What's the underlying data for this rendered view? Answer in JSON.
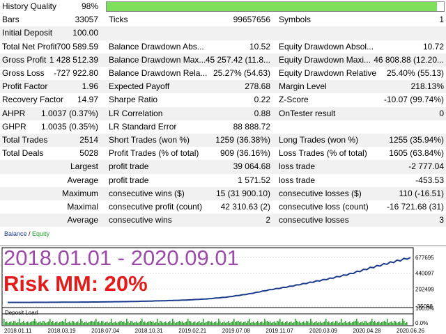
{
  "history_quality": {
    "label": "History Quality",
    "value": "98%",
    "fraction": 0.98
  },
  "stats": [
    {
      "l1": "Bars",
      "v1": "33057",
      "l2": "Ticks",
      "v2": "99657656",
      "l3": "Symbols",
      "v3": "1"
    },
    {
      "l1": "Initial Deposit",
      "v1": "100.00",
      "l2": "",
      "v2": "",
      "l3": "",
      "v3": ""
    },
    {
      "l1": "Total Net Profit",
      "v1": "700 589.59",
      "l2": "Balance Drawdown Abs...",
      "v2": "10.52",
      "l3": "Equity Drawdown Absol...",
      "v3": "10.72"
    },
    {
      "l1": "Gross Profit",
      "v1": "1 428 512.39",
      "l2": "Balance Drawdown Max...",
      "v2": "45 257.42 (11.8...",
      "l3": "Equity Drawdown Maxi...",
      "v3": "46 808.88 (12.20..."
    },
    {
      "l1": "Gross Loss",
      "v1": "-727 922.80",
      "l2": "Balance Drawdown Rela...",
      "v2": "25.27% (54.63)",
      "l3": "Equity Drawdown Relative",
      "v3": "25.40% (55.13)"
    },
    {
      "l1": "Profit Factor",
      "v1": "1.96",
      "l2": "Expected Payoff",
      "v2": "278.68",
      "l3": "Margin Level",
      "v3": "218.13%"
    },
    {
      "l1": "Recovery Factor",
      "v1": "14.97",
      "l2": "Sharpe Ratio",
      "v2": "0.22",
      "l3": "Z-Score",
      "v3": "-10.07 (99.74%)"
    },
    {
      "l1": "AHPR",
      "v1": "1.0037 (0.37%)",
      "l2": "LR Correlation",
      "v2": "0.88",
      "l3": "OnTester result",
      "v3": "0"
    },
    {
      "l1": "GHPR",
      "v1": "1.0035 (0.35%)",
      "l2": "LR Standard Error",
      "v2": "88 888.72",
      "l3": "",
      "v3": ""
    },
    {
      "l1": "Total Trades",
      "v1": "2514",
      "l2": "Short Trades (won %)",
      "v2": "1259 (36.38%)",
      "l3": "Long Trades (won %)",
      "v3": "1255 (35.94%)"
    },
    {
      "l1": "Total Deals",
      "v1": "5028",
      "l2": "Profit Trades (% of total)",
      "v2": "909 (36.16%)",
      "l3": "Loss Trades (% of total)",
      "v3": "1605 (63.84%)"
    }
  ],
  "detail_rows": [
    {
      "lr": "Largest",
      "l2": "profit trade",
      "v2": "39 064.68",
      "l3": "loss trade",
      "v3": "-2 777.04"
    },
    {
      "lr": "Average",
      "l2": "profit trade",
      "v2": "1 571.52",
      "l3": "loss trade",
      "v3": "-453.53"
    },
    {
      "lr": "Maximum",
      "l2": "consecutive wins ($)",
      "v2": "15 (31 900.10)",
      "l3": "consecutive losses ($)",
      "v3": "110 (-16.51)"
    },
    {
      "lr": "Maximal",
      "l2": "consecutive profit (count)",
      "v2": "42 310.63 (2)",
      "l3": "consecutive loss (count)",
      "v3": "-16 721.68 (31)"
    },
    {
      "lr": "Average",
      "l2": "consecutive wins",
      "v2": "2",
      "l3": "consecutive losses",
      "v3": "3"
    }
  ],
  "overlay": {
    "period": "2018.01.01 - 2020.09.01",
    "risk": "Risk MM: 20%"
  },
  "chart_data": [
    {
      "type": "line",
      "legend": [
        "Balance",
        "Equity"
      ],
      "yticks": [
        "677695",
        "440097",
        "202499",
        "-35098"
      ],
      "ylim": [
        -35098,
        720000
      ],
      "colors": {
        "balance": "#1a3a8c",
        "equity": "#28a028"
      },
      "x": [
        0,
        5,
        10,
        15,
        20,
        25,
        30,
        35,
        40,
        45,
        50,
        55,
        60,
        65,
        70,
        75,
        80,
        85,
        90,
        95,
        100
      ],
      "series": [
        {
          "name": "Balance",
          "values": [
            100,
            800,
            2000,
            4000,
            6000,
            9000,
            13000,
            20000,
            28000,
            38000,
            55000,
            85000,
            130000,
            190000,
            240000,
            300000,
            360000,
            430000,
            520000,
            600000,
            677695
          ]
        }
      ]
    },
    {
      "type": "bar",
      "title": "Deposit Load",
      "yticks": [
        "100.0%",
        "0.0%"
      ],
      "xticks": [
        "2018.01.11",
        "2018.03.19",
        "2018.07.04",
        "2018.10.31",
        "2019.02.21",
        "2019.07.08",
        "2019.11.07",
        "2020.03.09",
        "2020.04.28",
        "2020.06.26"
      ],
      "color": "#2ea82e"
    }
  ]
}
